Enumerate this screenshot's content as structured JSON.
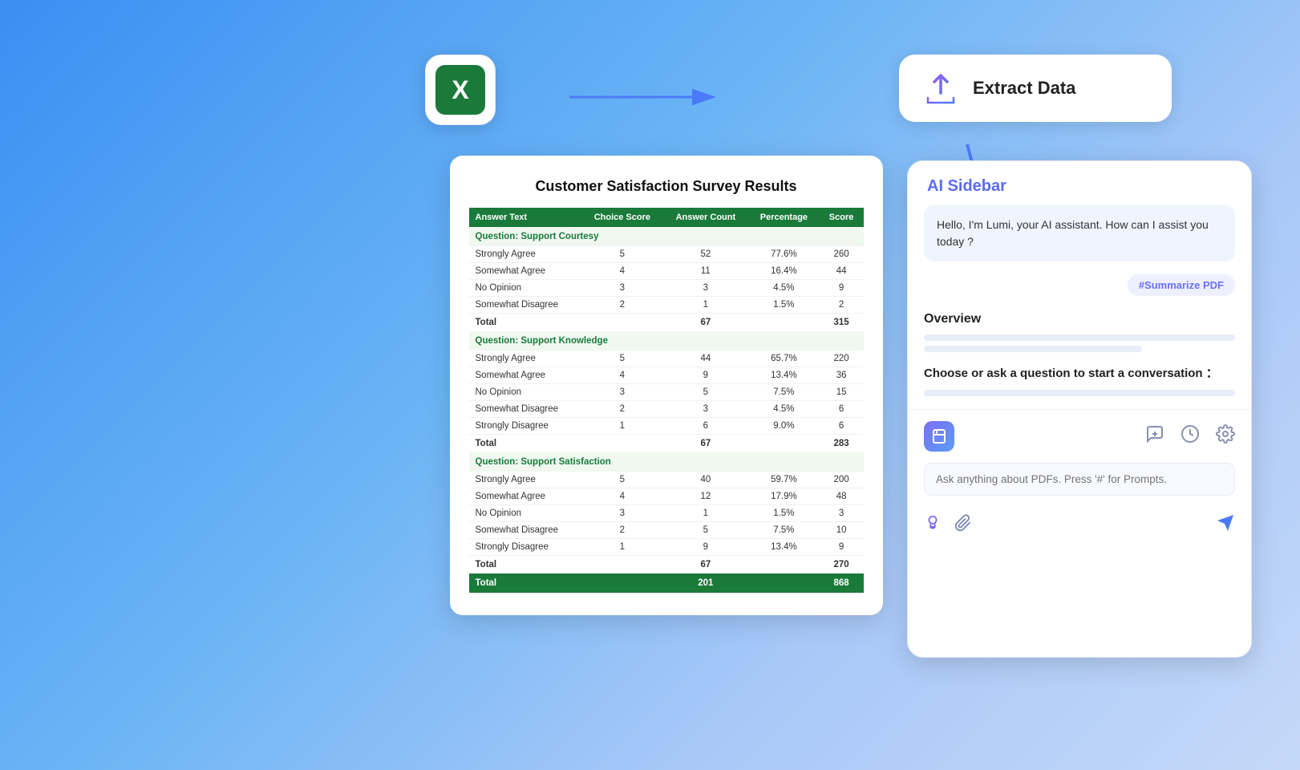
{
  "sheet": {
    "title": "Customer Satisfaction Survey Results",
    "columns": [
      "Answer Text",
      "Choice Score",
      "Answer Count",
      "Percentage",
      "Score"
    ],
    "sections": [
      {
        "header": "Question: Support Courtesy",
        "rows": [
          {
            "text": "Strongly Agree",
            "score": "5",
            "count": "52",
            "pct": "77.6%",
            "total": "260"
          },
          {
            "text": "Somewhat Agree",
            "score": "4",
            "count": "11",
            "pct": "16.4%",
            "total": "44"
          },
          {
            "text": "No Opinion",
            "score": "3",
            "count": "3",
            "pct": "4.5%",
            "total": "9"
          },
          {
            "text": "Somewhat Disagree",
            "score": "2",
            "count": "1",
            "pct": "1.5%",
            "total": "2"
          }
        ],
        "total": {
          "label": "Total",
          "count": "67",
          "score": "315"
        }
      },
      {
        "header": "Question: Support Knowledge",
        "rows": [
          {
            "text": "Strongly Agree",
            "score": "5",
            "count": "44",
            "pct": "65.7%",
            "total": "220"
          },
          {
            "text": "Somewhat Agree",
            "score": "4",
            "count": "9",
            "pct": "13.4%",
            "total": "36"
          },
          {
            "text": "No Opinion",
            "score": "3",
            "count": "5",
            "pct": "7.5%",
            "total": "15"
          },
          {
            "text": "Somewhat Disagree",
            "score": "2",
            "count": "3",
            "pct": "4.5%",
            "total": "6"
          },
          {
            "text": "Strongly Disagree",
            "score": "1",
            "count": "6",
            "pct": "9.0%",
            "total": "6"
          }
        ],
        "total": {
          "label": "Total",
          "count": "67",
          "score": "283"
        }
      },
      {
        "header": "Question: Support Satisfaction",
        "rows": [
          {
            "text": "Strongly Agree",
            "score": "5",
            "count": "40",
            "pct": "59.7%",
            "total": "200"
          },
          {
            "text": "Somewhat Agree",
            "score": "4",
            "count": "12",
            "pct": "17.9%",
            "total": "48"
          },
          {
            "text": "No Opinion",
            "score": "3",
            "count": "1",
            "pct": "1.5%",
            "total": "3"
          },
          {
            "text": "Somewhat Disagree",
            "score": "2",
            "count": "5",
            "pct": "7.5%",
            "total": "10"
          },
          {
            "text": "Strongly Disagree",
            "score": "1",
            "count": "9",
            "pct": "13.4%",
            "total": "9"
          }
        ],
        "total": {
          "label": "Total",
          "count": "67",
          "score": "270"
        }
      }
    ],
    "grand_total": {
      "label": "Total",
      "count": "201",
      "score": "868"
    }
  },
  "extract_card": {
    "title": "Extract Data"
  },
  "excel_icon": {
    "letter": "X"
  },
  "ai_sidebar": {
    "title": "AI Sidebar",
    "greeting": "Hello, I'm Lumi, your AI assistant. How can I assist you today ?",
    "hashtag": "#Summarize PDF",
    "overview_title": "Overview",
    "conversation_prompt": "Choose or ask a question to start a conversation ：",
    "input_placeholder": "Ask anything about PDFs. Press '#' for Prompts."
  }
}
